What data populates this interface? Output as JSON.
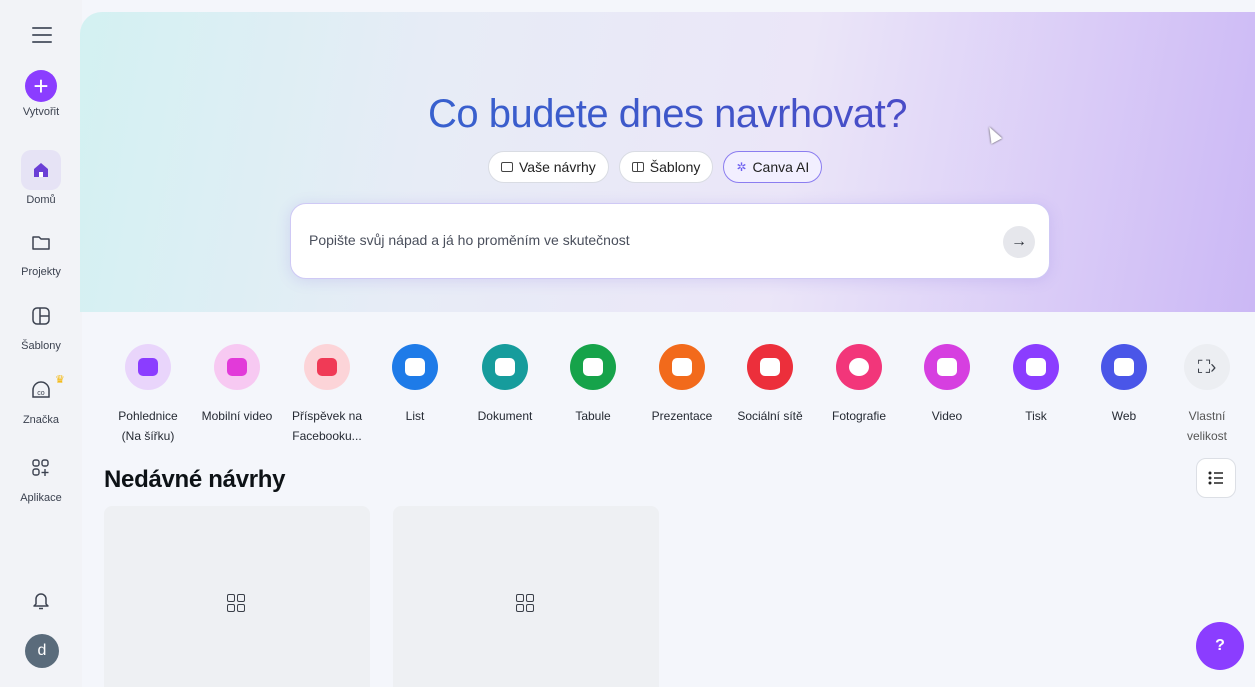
{
  "sidebar": {
    "create_label": "Vytvořit",
    "items": [
      {
        "label": "Domů",
        "icon": "home-icon"
      },
      {
        "label": "Projekty",
        "icon": "folder-icon"
      },
      {
        "label": "Šablony",
        "icon": "template-icon"
      },
      {
        "label": "Značka",
        "icon": "brand-icon"
      },
      {
        "label": "Aplikace",
        "icon": "apps-icon"
      }
    ],
    "avatar_letter": "d"
  },
  "hero": {
    "title": "Co budete dnes navrhovat?",
    "tabs": [
      {
        "label": "Vaše návrhy",
        "icon": "folder-icon"
      },
      {
        "label": "Šablony",
        "icon": "template-icon"
      },
      {
        "label": "Canva AI",
        "icon": "sparkle-icon"
      }
    ],
    "search_placeholder": "Popište svůj nápad a já ho proměním ve skutečnost"
  },
  "categories": [
    {
      "label": "Pohlednice",
      "label2": "(Na šířku)",
      "color": "#e9d5fb",
      "icon_color": "#8b3dff"
    },
    {
      "label": "Mobilní video",
      "label2": "",
      "color": "#f7c9f2",
      "icon_color": "#e23ad9"
    },
    {
      "label": "Příspěvek na",
      "label2": "Facebooku...",
      "color": "#fcd4d8",
      "icon_color": "#f03a56"
    },
    {
      "label": "List",
      "label2": "",
      "color": "#1e7be8",
      "icon_color": "#1e7be8"
    },
    {
      "label": "Dokument",
      "label2": "",
      "color": "#169c9c",
      "icon_color": "#169c9c"
    },
    {
      "label": "Tabule",
      "label2": "",
      "color": "#16a34a",
      "icon_color": "#16a34a"
    },
    {
      "label": "Prezentace",
      "label2": "",
      "color": "#f26a1b",
      "icon_color": "#f26a1b"
    },
    {
      "label": "Sociální sítě",
      "label2": "",
      "color": "#ec2f3b",
      "icon_color": "#ec2f3b"
    },
    {
      "label": "Fotografie",
      "label2": "",
      "color": "#f2367a",
      "icon_color": "#f2367a"
    },
    {
      "label": "Video",
      "label2": "",
      "color": "#d63fe0",
      "icon_color": "#d63fe0"
    },
    {
      "label": "Tisk",
      "label2": "",
      "color": "#8b3dff",
      "icon_color": "#8b3dff"
    },
    {
      "label": "Web",
      "label2": "",
      "color": "#4a56e8",
      "icon_color": "#4a56e8"
    },
    {
      "label": "Vlastní",
      "label2": "velikost",
      "color": "#eceef2",
      "icon_color": "#3a3f48"
    }
  ],
  "recent": {
    "title": "Nedávné návrhy"
  },
  "help_label": "?"
}
